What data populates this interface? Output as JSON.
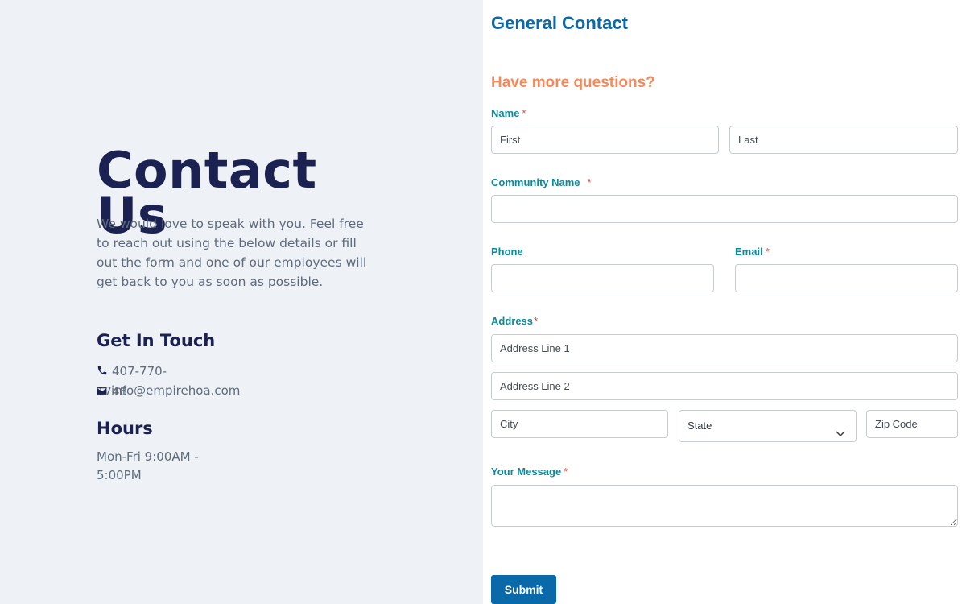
{
  "left": {
    "title": "Contact Us",
    "intro": "We would love to speak with you. Feel free to reach out using the below details or fill out the form and one of our employees will get back to you as soon as possible.",
    "get_in_touch_heading": "Get In Touch",
    "phone": "407-770-1748",
    "email": "info@empirehoa.com",
    "phone_icon": "phone-icon",
    "email_icon": "envelope-icon",
    "hours_heading": "Hours",
    "hours": "Mon-Fri 9:00AM - 5:00PM"
  },
  "form": {
    "title": "General Contact",
    "subtitle": "Have more questions?",
    "name_label": "Name",
    "first_placeholder": "First",
    "last_placeholder": "Last",
    "community_label": "Community Name",
    "phone_label": "Phone",
    "email_label": "Email",
    "address_label": "Address",
    "address1_placeholder": "Address Line 1",
    "address2_placeholder": "Address Line 2",
    "city_placeholder": "City",
    "state_selected": "State",
    "zip_placeholder": "Zip Code",
    "message_label": "Your Message",
    "required_marker": "*",
    "submit_label": "Submit"
  },
  "colors": {
    "left_background": "#eef1f6",
    "heading": "#1b2151",
    "form_title": "#0a69a8",
    "subtitle": "#f28a5c",
    "label": "#0c8a9b",
    "required": "#e2473e",
    "submit": "#0a69a8"
  }
}
